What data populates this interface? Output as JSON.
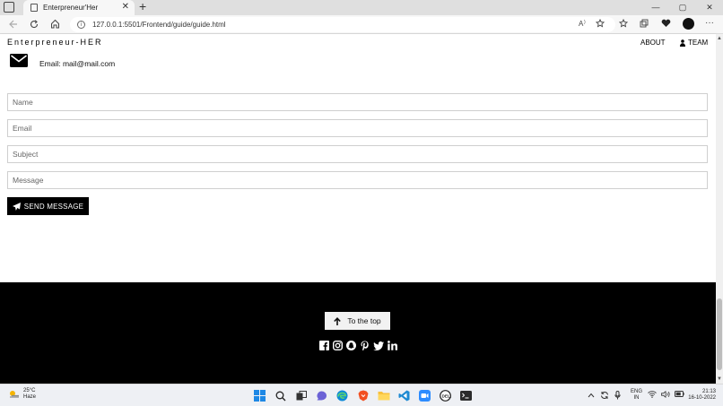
{
  "browser": {
    "tab_title": "Enterpreneur'Her",
    "tab_close": "✕",
    "new_tab": "+",
    "url": "127.0.0.1:5501/Frontend/guide/guide.html",
    "window_controls": {
      "minimize": "—",
      "maximize": "▢",
      "close": "✕"
    },
    "toolbar_more": "···"
  },
  "site": {
    "brand": "Enterpreneur-HER",
    "nav": {
      "about": "ABOUT",
      "team": "TEAM"
    }
  },
  "contact": {
    "email_line": "Email: mail@mail.com",
    "form": {
      "name_placeholder": "Name",
      "email_placeholder": "Email",
      "subject_placeholder": "Subject",
      "message_placeholder": "Message",
      "send_label": "SEND MESSAGE"
    }
  },
  "footer": {
    "to_top_label": "To the top",
    "socials": [
      "facebook-icon",
      "instagram-icon",
      "snapchat-icon",
      "pinterest-icon",
      "twitter-icon",
      "linkedin-icon"
    ]
  },
  "taskbar": {
    "weather": {
      "temp": "25°C",
      "condition": "Haze"
    },
    "language": {
      "line1": "ENG",
      "line2": "IN"
    },
    "clock": {
      "time": "21:13",
      "date": "16-10-2022"
    }
  },
  "colors": {
    "footer_bg": "#000000",
    "button_bg": "#000000",
    "button_text": "#ffffff"
  }
}
